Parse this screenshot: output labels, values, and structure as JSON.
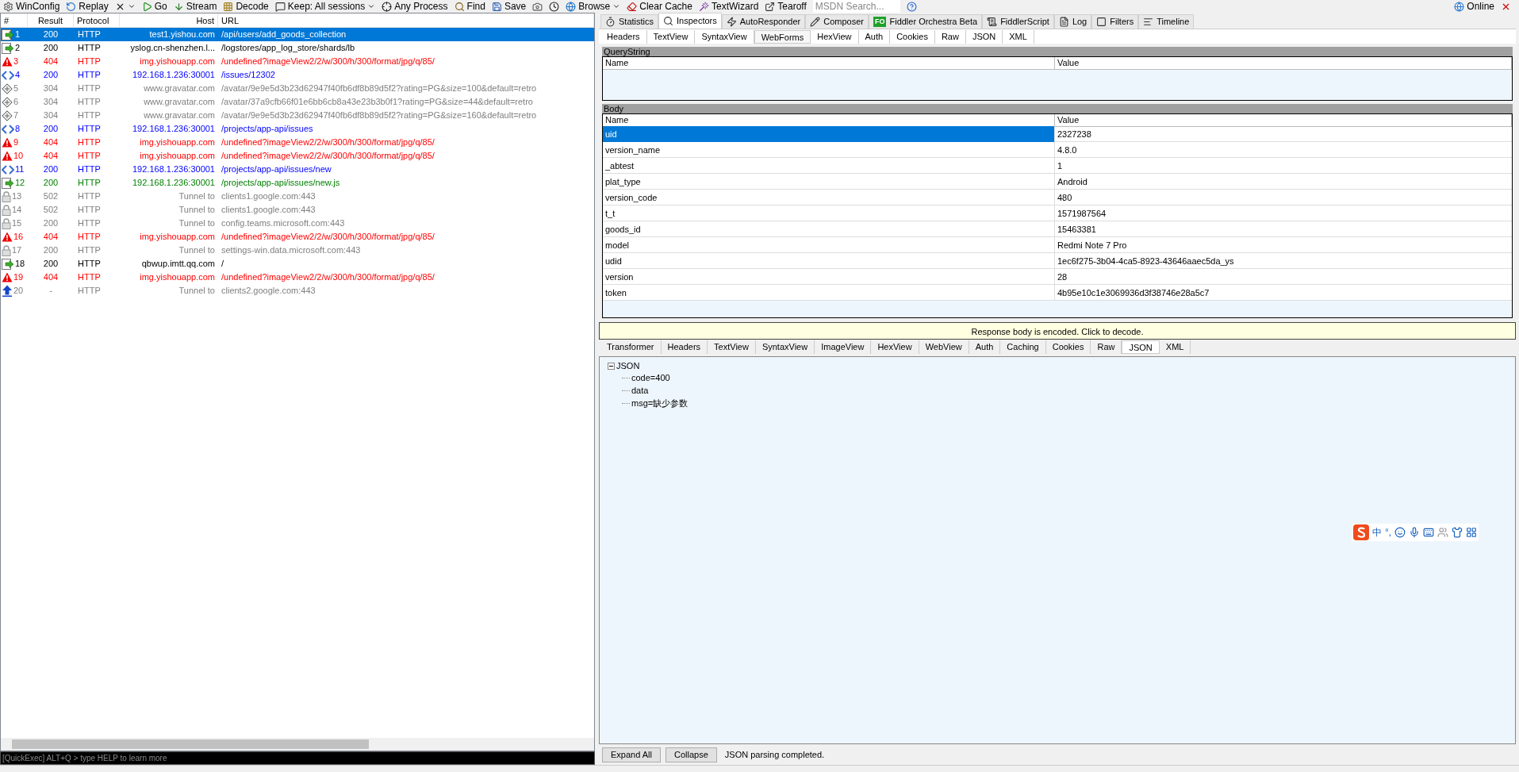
{
  "toolbar": [
    {
      "kind": "config",
      "label": "WinConfig"
    },
    {
      "kind": "replay",
      "label": "Replay"
    },
    {
      "kind": "remove",
      "dropdown": true
    },
    {
      "kind": "go",
      "label": "Go"
    },
    {
      "kind": "stream",
      "label": "Stream"
    },
    {
      "kind": "decode",
      "label": "Decode"
    },
    {
      "kind": "keep",
      "label": "Keep: All sessions",
      "dropdown": true
    },
    {
      "kind": "process",
      "label": "Any Process"
    },
    {
      "kind": "find",
      "label": "Find"
    },
    {
      "kind": "save",
      "label": "Save"
    },
    {
      "kind": "screenshot"
    },
    {
      "kind": "timer"
    },
    {
      "kind": "browse",
      "label": "Browse",
      "dropdown": true
    },
    {
      "kind": "clear",
      "label": "Clear Cache"
    },
    {
      "kind": "wizard",
      "label": "TextWizard"
    },
    {
      "kind": "tearoff",
      "label": "Tearoff"
    }
  ],
  "msdn_search": {
    "placeholder": "MSDN Search..."
  },
  "online": {
    "label": "Online"
  },
  "sessions": {
    "columns": [
      "#",
      "Result",
      "Protocol",
      "Host",
      "URL"
    ],
    "rows": [
      {
        "num": "1",
        "result": "200",
        "protocol": "HTTP",
        "host": "test1.yishou.com",
        "url": "/api/users/add_goods_collection",
        "kind": "response",
        "selected": true
      },
      {
        "num": "2",
        "result": "200",
        "protocol": "HTTP",
        "host": "yslog.cn-shenzhen.l...",
        "url": "/logstores/app_log_store/shards/lb",
        "kind": "response",
        "color": "#000000",
        "selected": false
      },
      {
        "num": "3",
        "result": "404",
        "protocol": "HTTP",
        "host": "img.yishouapp.com",
        "url": "/undefined?imageView2/2/w/300/h/300/format/jpg/q/85/",
        "kind": "error",
        "color": "#ff0000",
        "selected": false
      },
      {
        "num": "4",
        "result": "200",
        "protocol": "HTTP",
        "host": "192.168.1.236:30001",
        "url": "/issues/12302",
        "kind": "html",
        "color": "#0000ff",
        "selected": false
      },
      {
        "num": "5",
        "result": "304",
        "protocol": "HTTP",
        "host": "www.gravatar.com",
        "url": "/avatar/9e9e5d3b23d62947f40fb6df8b89d5f2?rating=PG&size=100&default=retro",
        "kind": "cached",
        "color": "#808080",
        "selected": false
      },
      {
        "num": "6",
        "result": "304",
        "protocol": "HTTP",
        "host": "www.gravatar.com",
        "url": "/avatar/37a9cfb66f01e6bb6cb8a43e23b3b0f1?rating=PG&size=44&default=retro",
        "kind": "cached",
        "color": "#808080",
        "selected": false
      },
      {
        "num": "7",
        "result": "304",
        "protocol": "HTTP",
        "host": "www.gravatar.com",
        "url": "/avatar/9e9e5d3b23d62947f40fb6df8b89d5f2?rating=PG&size=160&default=retro",
        "kind": "cached",
        "color": "#808080",
        "selected": false
      },
      {
        "num": "8",
        "result": "200",
        "protocol": "HTTP",
        "host": "192.168.1.236:30001",
        "url": "/projects/app-api/issues",
        "kind": "html",
        "color": "#0000ff",
        "selected": false
      },
      {
        "num": "9",
        "result": "404",
        "protocol": "HTTP",
        "host": "img.yishouapp.com",
        "url": "/undefined?imageView2/2/w/300/h/300/format/jpg/q/85/",
        "kind": "error",
        "color": "#ff0000",
        "selected": false
      },
      {
        "num": "10",
        "result": "404",
        "protocol": "HTTP",
        "host": "img.yishouapp.com",
        "url": "/undefined?imageView2/2/w/300/h/300/format/jpg/q/85/",
        "kind": "error",
        "color": "#ff0000",
        "selected": false
      },
      {
        "num": "11",
        "result": "200",
        "protocol": "HTTP",
        "host": "192.168.1.236:30001",
        "url": "/projects/app-api/issues/new",
        "kind": "html",
        "color": "#0000ff",
        "selected": false
      },
      {
        "num": "12",
        "result": "200",
        "protocol": "HTTP",
        "host": "192.168.1.236:30001",
        "url": "/projects/app-api/issues/new.js",
        "kind": "response",
        "color": "#008000",
        "selected": false
      },
      {
        "num": "13",
        "result": "502",
        "protocol": "HTTP",
        "host": "Tunnel to",
        "url": "clients1.google.com:443",
        "kind": "tunnel",
        "color": "#808080",
        "selected": false
      },
      {
        "num": "14",
        "result": "502",
        "protocol": "HTTP",
        "host": "Tunnel to",
        "url": "clients1.google.com:443",
        "kind": "tunnel",
        "color": "#808080",
        "selected": false
      },
      {
        "num": "15",
        "result": "200",
        "protocol": "HTTP",
        "host": "Tunnel to",
        "url": "config.teams.microsoft.com:443",
        "kind": "tunnel",
        "color": "#808080",
        "selected": false
      },
      {
        "num": "16",
        "result": "404",
        "protocol": "HTTP",
        "host": "img.yishouapp.com",
        "url": "/undefined?imageView2/2/w/300/h/300/format/jpg/q/85/",
        "kind": "error",
        "color": "#ff0000",
        "selected": false
      },
      {
        "num": "17",
        "result": "200",
        "protocol": "HTTP",
        "host": "Tunnel to",
        "url": "settings-win.data.microsoft.com:443",
        "kind": "tunnel",
        "color": "#808080",
        "selected": false
      },
      {
        "num": "18",
        "result": "200",
        "protocol": "HTTP",
        "host": "qbwup.imtt.qq.com",
        "url": "/",
        "kind": "response",
        "color": "#000000",
        "selected": false
      },
      {
        "num": "19",
        "result": "404",
        "protocol": "HTTP",
        "host": "img.yishouapp.com",
        "url": "/undefined?imageView2/2/w/300/h/300/format/jpg/q/85/",
        "kind": "error",
        "color": "#ff0000",
        "selected": false
      },
      {
        "num": "20",
        "result": "-",
        "protocol": "HTTP",
        "host": "Tunnel to",
        "url": "clients2.google.com:443",
        "kind": "upload",
        "color": "#808080",
        "selected": false
      }
    ]
  },
  "quickexec": {
    "placeholder": "[QuickExec] ALT+Q > type HELP to learn more"
  },
  "inspector_tabs": [
    {
      "label": "Statistics",
      "kind": "timer",
      "selected": false
    },
    {
      "label": "Inspectors",
      "kind": "inspect",
      "selected": true
    },
    {
      "label": "AutoResponder",
      "kind": "bolt",
      "selected": false
    },
    {
      "label": "Composer",
      "kind": "compose",
      "selected": false
    },
    {
      "label": "Fiddler Orchestra Beta",
      "kind": "badge",
      "badge": "FO",
      "selected": false
    },
    {
      "label": "FiddlerScript",
      "kind": "script",
      "selected": false
    },
    {
      "label": "Log",
      "kind": "log",
      "selected": false
    },
    {
      "label": "Filters",
      "kind": "filter",
      "selected": false
    },
    {
      "label": "Timeline",
      "kind": "timeline",
      "selected": false
    }
  ],
  "request_tabs": [
    {
      "label": "Headers",
      "selected": false
    },
    {
      "label": "TextView",
      "selected": false
    },
    {
      "label": "SyntaxView",
      "selected": false
    },
    {
      "label": "WebForms",
      "selected": true
    },
    {
      "label": "HexView",
      "selected": false
    },
    {
      "label": "Auth",
      "selected": false
    },
    {
      "label": "Cookies",
      "selected": false
    },
    {
      "label": "Raw",
      "selected": false
    },
    {
      "label": "JSON",
      "selected": false
    },
    {
      "label": "XML",
      "selected": false
    }
  ],
  "querystring": {
    "title": "QueryString",
    "columns": [
      "Name",
      "Value"
    ]
  },
  "body": {
    "title": "Body",
    "columns": [
      "Name",
      "Value"
    ],
    "rows": [
      {
        "name": "uid",
        "value": "2327238",
        "selected": true
      },
      {
        "name": "version_name",
        "value": "4.8.0",
        "selected": false
      },
      {
        "name": "_abtest",
        "value": "1",
        "selected": false
      },
      {
        "name": "plat_type",
        "value": "Android",
        "selected": false
      },
      {
        "name": "version_code",
        "value": "480",
        "selected": false
      },
      {
        "name": "t_t",
        "value": "1571987564",
        "selected": false
      },
      {
        "name": "goods_id",
        "value": "15463381",
        "selected": false
      },
      {
        "name": "model",
        "value": "Redmi Note 7 Pro",
        "selected": false
      },
      {
        "name": "udid",
        "value": "1ec6f275-3b04-4ca5-8923-43646aaec5da_ys",
        "selected": false
      },
      {
        "name": "version",
        "value": "28",
        "selected": false
      },
      {
        "name": "token",
        "value": "4b95e10c1e3069936d3f38746e28a5c7",
        "selected": false
      }
    ]
  },
  "response_banner": "Response body is encoded. Click to decode.",
  "response_tabs": [
    {
      "label": "Transformer",
      "selected": false
    },
    {
      "label": "Headers",
      "selected": false
    },
    {
      "label": "TextView",
      "selected": false
    },
    {
      "label": "SyntaxView",
      "selected": false
    },
    {
      "label": "ImageView",
      "selected": false
    },
    {
      "label": "HexView",
      "selected": false
    },
    {
      "label": "WebView",
      "selected": false
    },
    {
      "label": "Auth",
      "selected": false
    },
    {
      "label": "Caching",
      "selected": false
    },
    {
      "label": "Cookies",
      "selected": false
    },
    {
      "label": "Raw",
      "selected": false
    },
    {
      "label": "JSON",
      "selected": true
    },
    {
      "label": "XML",
      "selected": false
    }
  ],
  "json_tree": {
    "label": "JSON",
    "expanded": true,
    "children": [
      {
        "label": "code=400"
      },
      {
        "label": "data"
      },
      {
        "label": "msg=缺少参数"
      }
    ]
  },
  "buttons": [
    "Expand All",
    "Collapse"
  ],
  "status": "JSON parsing completed.",
  "ime": {
    "mode": "中",
    "punct": "°,"
  }
}
